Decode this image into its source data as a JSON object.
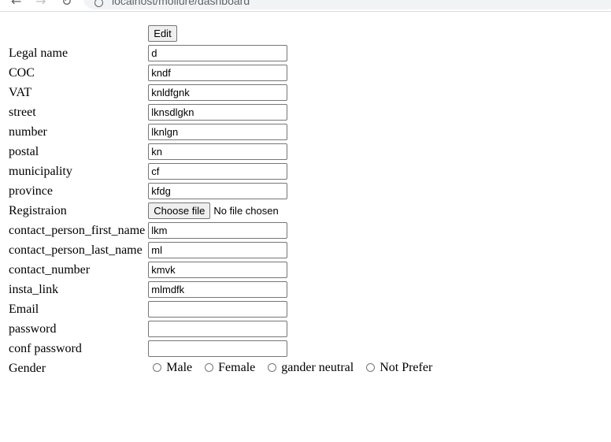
{
  "browser": {
    "url": "localhost/mollure/dashboard"
  },
  "form": {
    "edit_label": "Edit",
    "fields": [
      {
        "label": "Legal name",
        "value": "d"
      },
      {
        "label": "COC",
        "value": "kndf"
      },
      {
        "label": "VAT",
        "value": "knldfgnk"
      },
      {
        "label": "street",
        "value": "lknsdlgkn"
      },
      {
        "label": "number",
        "value": "lknlgn"
      },
      {
        "label": "postal",
        "value": "kn"
      },
      {
        "label": "municipality",
        "value": "cf"
      },
      {
        "label": "province",
        "value": "kfdg"
      }
    ],
    "registration": {
      "label": "Registraion",
      "button_label": "Choose file",
      "status": "No file chosen"
    },
    "fields2": [
      {
        "label": "contact_person_first_name",
        "value": "lkm"
      },
      {
        "label": "contact_person_last_name",
        "value": "ml"
      },
      {
        "label": "contact_number",
        "value": "kmvk"
      },
      {
        "label": "insta_link",
        "value": "mlmdfk"
      },
      {
        "label": "Email",
        "value": ""
      },
      {
        "label": "password",
        "value": ""
      },
      {
        "label": "conf password",
        "value": ""
      }
    ],
    "gender": {
      "label": "Gender",
      "options": [
        "Male",
        "Female",
        "gander neutral",
        "Not Prefer"
      ]
    }
  }
}
